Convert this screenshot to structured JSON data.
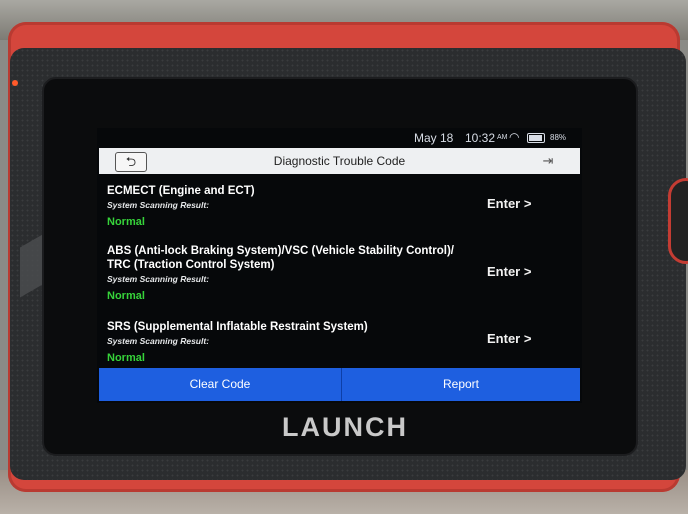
{
  "status_bar": {
    "date": "May 18",
    "time": "10:32",
    "ampm": "AM",
    "battery": "88%"
  },
  "header": {
    "title": "Diagnostic Trouble Code",
    "back_icon": "back-arrow-icon",
    "exit_icon": "exit-icon"
  },
  "systems": [
    {
      "name": "ECMECT (Engine and ECT)",
      "result_label": "System Scanning Result:",
      "result": "Normal",
      "action": "Enter >"
    },
    {
      "name": "ABS (Anti-lock Braking System)/VSC (Vehicle Stability Control)/ TRC (Traction Control System)",
      "result_label": "System Scanning Result:",
      "result": "Normal",
      "action": "Enter >"
    },
    {
      "name": "SRS (Supplemental Inflatable Restraint System)",
      "result_label": "System Scanning Result:",
      "result": "Normal",
      "action": "Enter >"
    }
  ],
  "footer": {
    "clear_label": "Clear Code",
    "report_label": "Report"
  },
  "brand": "LAUNCH",
  "colors": {
    "accent": "#1e5fe0",
    "normal": "#36d33a",
    "case": "#d4463c"
  }
}
